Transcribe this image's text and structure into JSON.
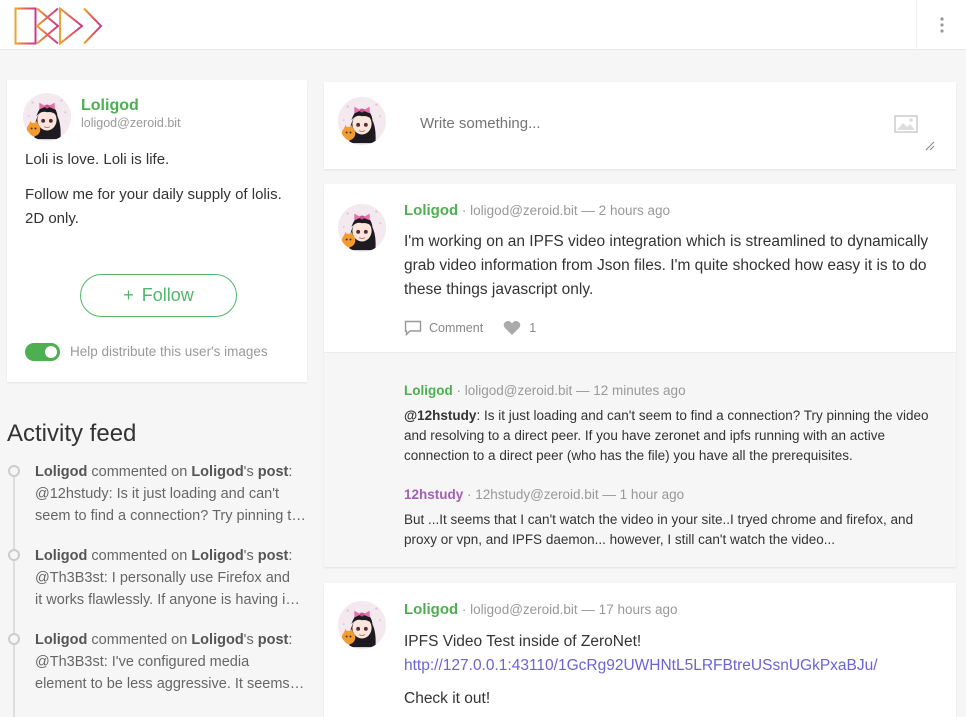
{
  "colors": {
    "accent": "#4caf50",
    "commenter2": "#a25fb6",
    "link": "#6b63d6"
  },
  "profile": {
    "name": "Loligod",
    "address": "loligod@zeroid.bit",
    "bio": [
      "Loli is love. Loli is life.",
      "Follow me for your daily supply of lolis. 2D only."
    ],
    "follow_label": "Follow",
    "follow_icon": "+",
    "distribute_label": "Help distribute this user's images",
    "distribute_on": true
  },
  "activity": {
    "title": "Activity feed",
    "items": [
      {
        "actor": "Loligod",
        "verb": "commented on",
        "owner": "Loligod",
        "possessive": "'s",
        "target": "post",
        "punct": ":",
        "lines": [
          "@12hstudy: Is it just loading and can't",
          "seem to find a connection? Try pinning the video"
        ]
      },
      {
        "actor": "Loligod",
        "verb": "commented on",
        "owner": "Loligod",
        "possessive": "'s",
        "target": "post",
        "punct": ":",
        "lines": [
          "@Th3B3st: I personally use Firefox and",
          "it works flawlessly. If anyone is having issues"
        ]
      },
      {
        "actor": "Loligod",
        "verb": "commented on",
        "owner": "Loligod",
        "possessive": "'s",
        "target": "post",
        "punct": ":",
        "lines": [
          "@Th3B3st: I've configured media",
          "element to be less aggressive. It seems to help"
        ]
      }
    ]
  },
  "composer": {
    "placeholder": "Write something..."
  },
  "posts": [
    {
      "author": "Loligod",
      "meta": "· loligod@zeroid.bit — 2 hours ago",
      "body": "I'm working on an IPFS video integration which is streamlined to dynamically grab video information from Json files. I'm quite shocked how easy it is to do these things javascript only.",
      "comment_label": "Comment",
      "like_count": "1",
      "comments": [
        {
          "author": "Loligod",
          "meta": "· loligod@zeroid.bit — 12 minutes ago",
          "mention": "@12hstudy",
          "text": ": Is it just loading and can't seem to find a connection? Try pinning the video and resolving to a direct peer. If you have zeronet and ipfs running with an active connection to a direct peer (who has the file) you have all the prerequisites."
        },
        {
          "author": "12hstudy",
          "meta": "· 12hstudy@zeroid.bit — 1 hour ago",
          "text": "But ...It seems that I can't watch the video in your site..I tryed chrome and firefox, and proxy or vpn, and IPFS daemon... however, I still can't watch the video..."
        }
      ]
    },
    {
      "author": "Loligod",
      "meta": "· loligod@zeroid.bit — 17 hours ago",
      "title": "IPFS Video Test inside of ZeroNet!",
      "link": "http://127.0.0.1:43110/1GcRg92UWHNtL5LRFBtreUSsnUGkPxaBJu/",
      "body2": "Check it out!"
    }
  ]
}
